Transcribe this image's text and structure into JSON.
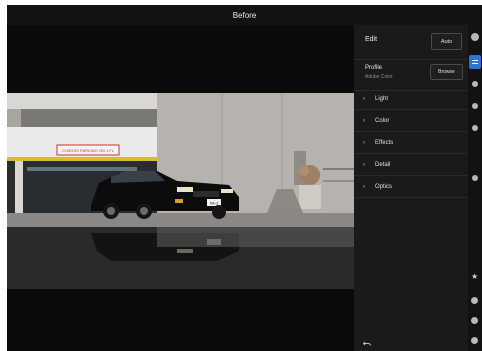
{
  "topbar": {
    "title": "Before"
  },
  "panel": {
    "title": "Edit",
    "auto_label": "Auto",
    "profile_label": "Profile",
    "profile_value": "Adobe Color",
    "browse_label": "Browse",
    "sections": [
      {
        "label": "Light",
        "icon": "chevron-right-icon"
      },
      {
        "label": "Color",
        "icon": "chevron-right-icon"
      },
      {
        "label": "Effects",
        "icon": "chevron-right-icon"
      },
      {
        "label": "Detail",
        "icon": "chevron-right-icon"
      },
      {
        "label": "Optics",
        "icon": "chevron-right-icon"
      }
    ]
  },
  "photo": {
    "sign_text": "CHIDORI PARKING ON 1 FL",
    "plate_text": "5A-3"
  },
  "colors": {
    "accent": "#2f73d8",
    "panel_bg": "#1a1a1a",
    "canvas_bg": "#0b0b0b"
  }
}
